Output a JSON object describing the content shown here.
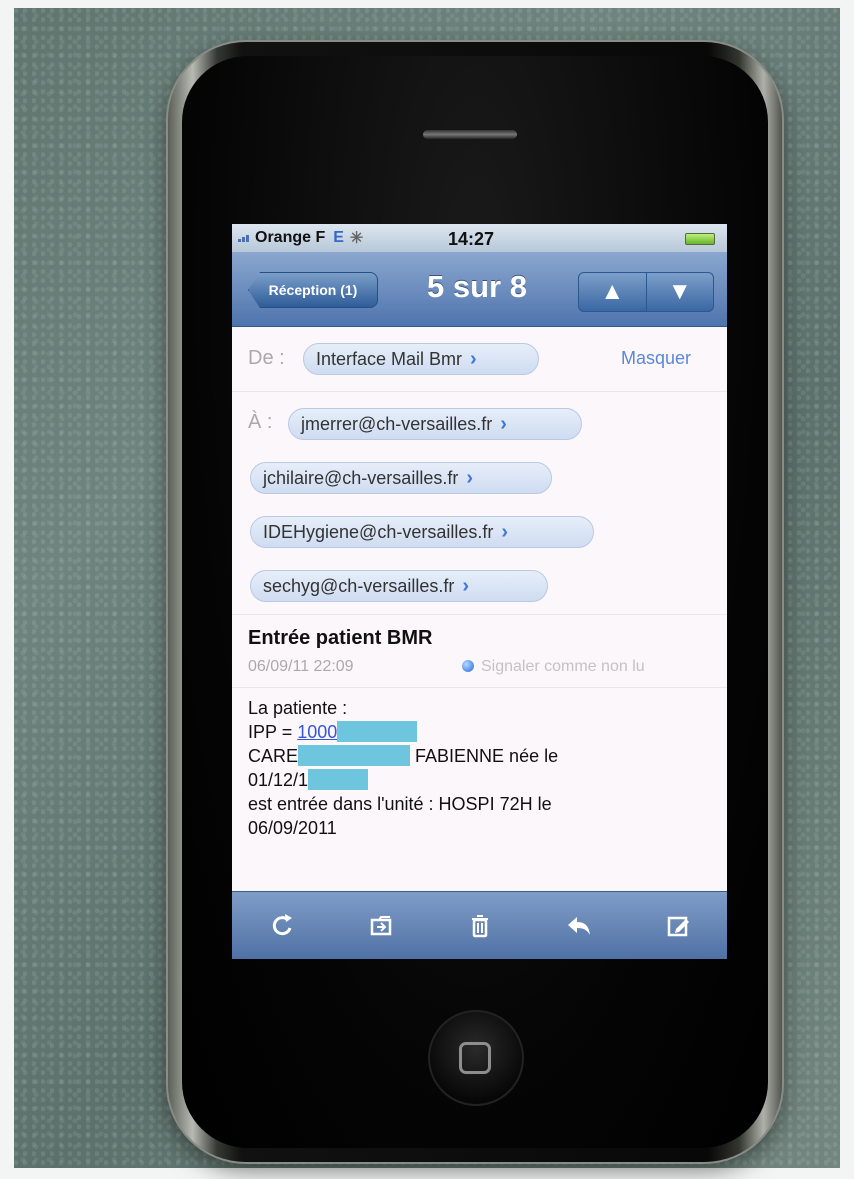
{
  "status": {
    "carrier": "Orange F",
    "network": "E",
    "time": "14:27"
  },
  "nav": {
    "back_label": "Réception (1)",
    "position": "5 sur 8",
    "up_symbol": "▲",
    "down_symbol": "▼"
  },
  "email": {
    "from_label": "De :",
    "from": "Interface Mail Bmr",
    "hide_label": "Masquer",
    "to_label": "À :",
    "recipients": [
      "jmerrer@ch-versailles.fr",
      "jchilaire@ch-versailles.fr",
      "IDEHygiene@ch-versailles.fr",
      "sechyg@ch-versailles.fr"
    ],
    "subject": "Entrée patient BMR",
    "date": "06/09/11 22:09",
    "mark_unread": "Signaler comme non lu",
    "body": {
      "line1": "La patiente :",
      "ipp_prefix": "IPP = ",
      "ipp_visible": "1000",
      "name_prefix": "CARE",
      "name_suffix": "FABIENNE née le",
      "dob_prefix": "01/12/1",
      "line5": "est entrée dans l'unité : HOSPI 72H le",
      "line6": "06/09/2011"
    }
  },
  "icons": {
    "refresh": "refresh-icon",
    "move": "folder-move-icon",
    "trash": "trash-icon",
    "reply": "reply-icon",
    "compose": "compose-icon"
  },
  "colors": {
    "nav_blue": "#4f74ad",
    "toolbar_blue": "#4f70a4",
    "redaction": "#6ec6de",
    "link": "#3657d8"
  }
}
